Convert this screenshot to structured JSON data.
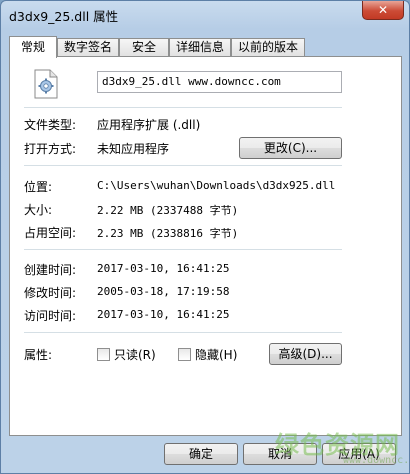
{
  "window": {
    "title": "d3dx9_25.dll 属性",
    "close_glyph": "✕"
  },
  "tabs": [
    {
      "label": "常规",
      "active": true
    },
    {
      "label": "数字签名",
      "active": false
    },
    {
      "label": "安全",
      "active": false
    },
    {
      "label": "详细信息",
      "active": false
    },
    {
      "label": "以前的版本",
      "active": false
    }
  ],
  "general": {
    "file_icon": "dll-file-icon",
    "file_name": "d3dx9_25.dll  www.downcc.com",
    "type_label": "文件类型:",
    "type_value": "应用程序扩展 (.dll)",
    "opens_label": "打开方式:",
    "opens_value": "未知应用程序",
    "change_button": "更改(C)...",
    "location_label": "位置:",
    "location_value": "C:\\Users\\wuhan\\Downloads\\d3dx925.dll",
    "size_label": "大小:",
    "size_value": "2.22 MB (2337488 字节)",
    "disk_size_label": "占用空间:",
    "disk_size_value": "2.23 MB (2338816 字节)",
    "created_label": "创建时间:",
    "created_value": "2017-03-10, 16:41:25",
    "modified_label": "修改时间:",
    "modified_value": "2005-03-18, 17:19:58",
    "accessed_label": "访问时间:",
    "accessed_value": "2017-03-10, 16:41:25",
    "attributes_label": "属性:",
    "readonly_label": "只读(R)",
    "readonly_checked": false,
    "hidden_label": "隐藏(H)",
    "hidden_checked": false,
    "advanced_button": "高级(D)..."
  },
  "footer": {
    "ok_button": "确定",
    "cancel_button": "取消",
    "apply_button": "应用(A)"
  },
  "watermark": {
    "main": "绿色资源网",
    "sub": "www.downcc.com"
  },
  "colors": {
    "title_bg": "#b9d1ea",
    "close_red": "#c7432e",
    "panel_bg": "#ffffff",
    "watermark_green": "#7fc050"
  }
}
